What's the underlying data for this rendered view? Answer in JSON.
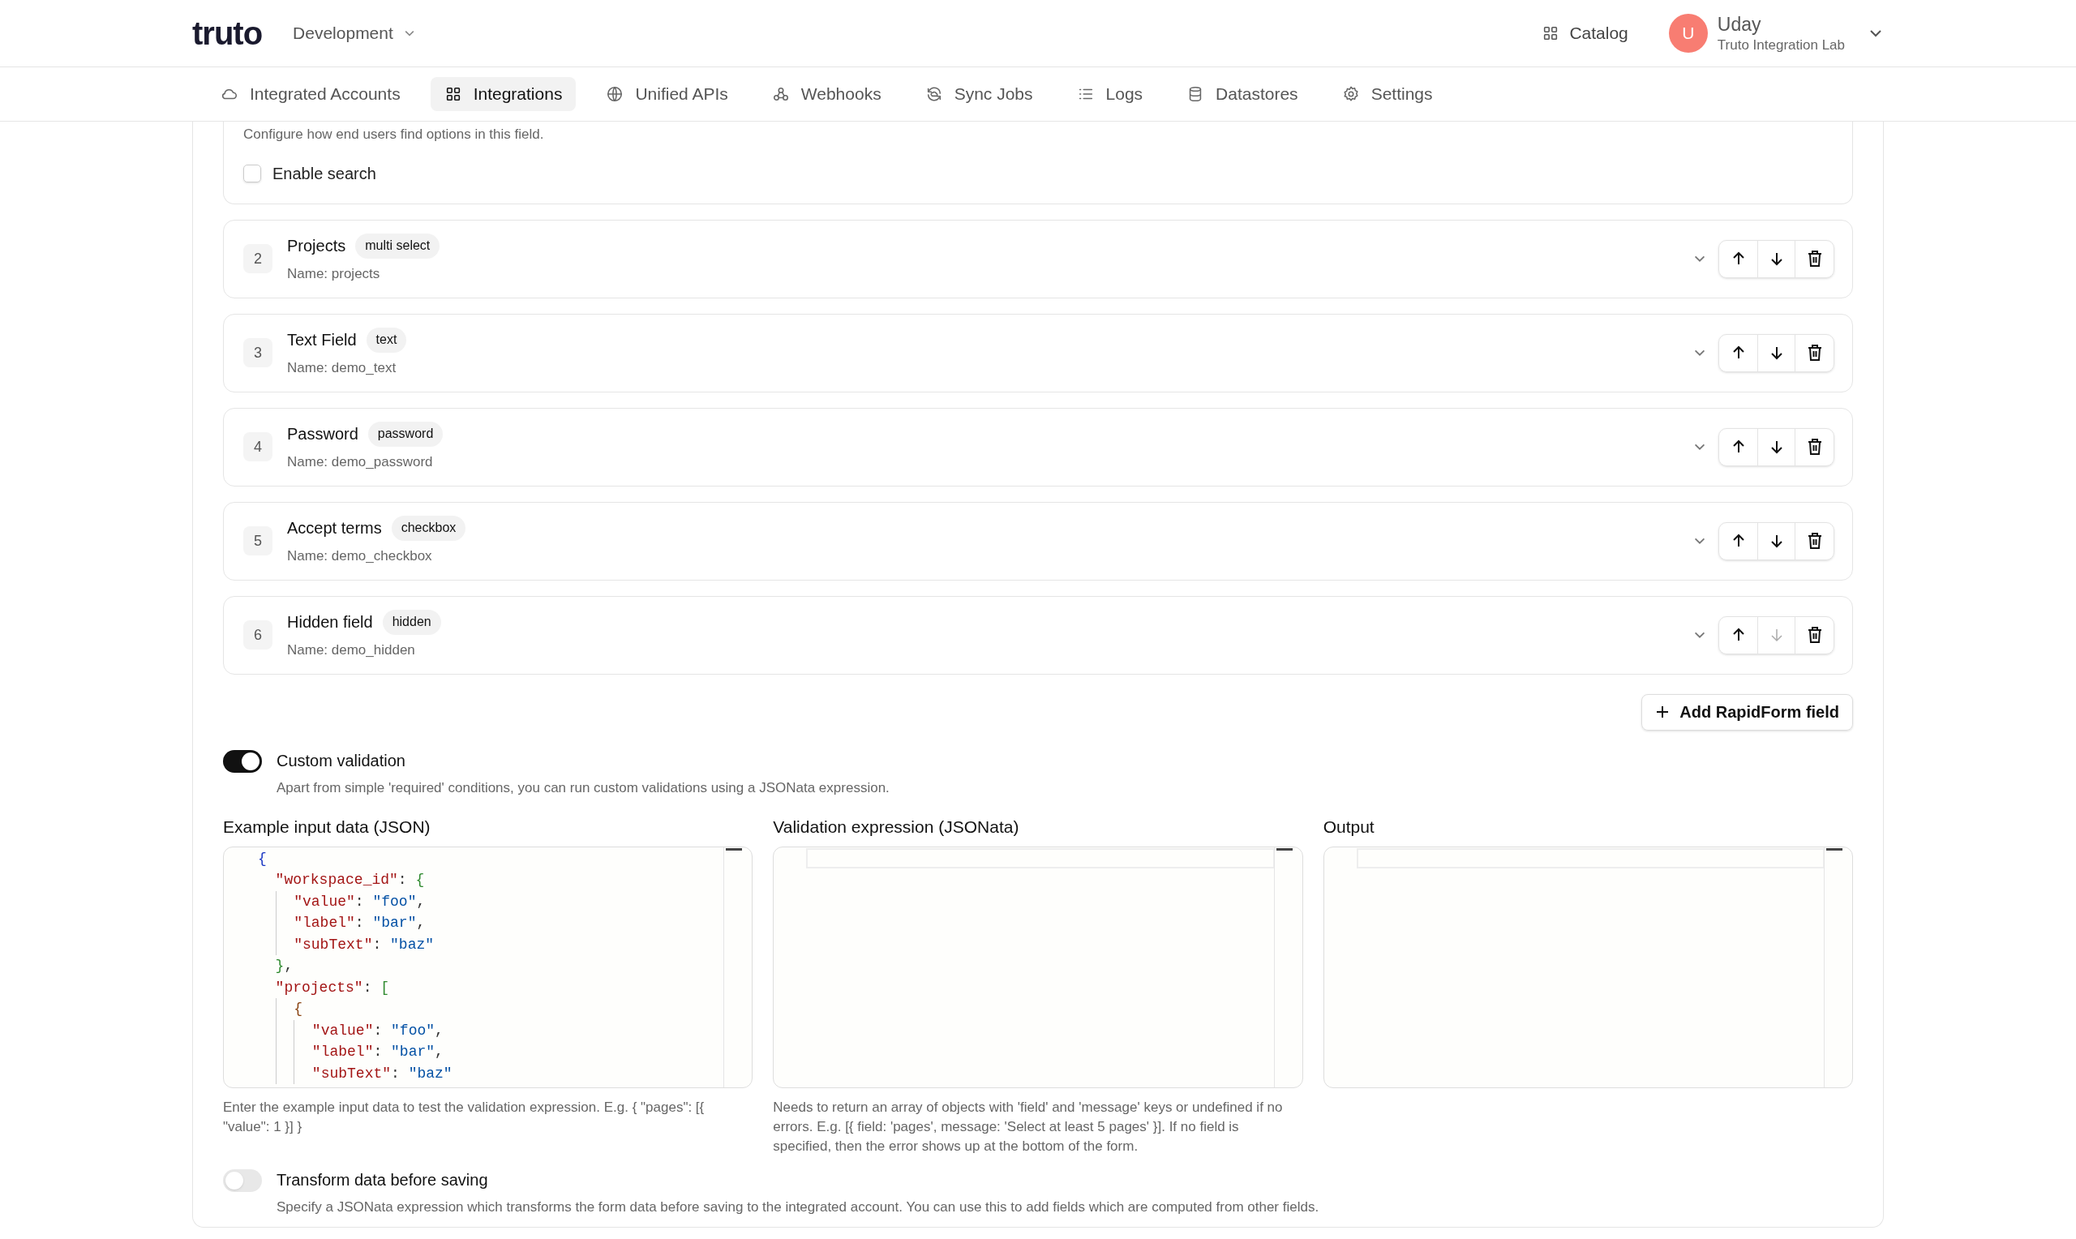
{
  "header": {
    "logo": "truto",
    "environment": "Development",
    "catalog": "Catalog",
    "user": {
      "initial": "U",
      "name": "Uday",
      "org": "Truto Integration Lab"
    }
  },
  "nav_tabs": [
    {
      "label": "Integrated Accounts",
      "selected": false
    },
    {
      "label": "Integrations",
      "selected": true
    },
    {
      "label": "Unified APIs",
      "selected": false
    },
    {
      "label": "Webhooks",
      "selected": false
    },
    {
      "label": "Sync Jobs",
      "selected": false
    },
    {
      "label": "Logs",
      "selected": false
    },
    {
      "label": "Datastores",
      "selected": false
    },
    {
      "label": "Settings",
      "selected": false
    }
  ],
  "search_config": {
    "description": "Configure how end users find options in this field.",
    "enable_search": {
      "label": "Enable search",
      "checked": false
    }
  },
  "fields": [
    {
      "number": "2",
      "title": "Projects",
      "type": "multi select",
      "name": "Name: projects",
      "down_disabled": false
    },
    {
      "number": "3",
      "title": "Text Field",
      "type": "text",
      "name": "Name: demo_text",
      "down_disabled": false
    },
    {
      "number": "4",
      "title": "Password",
      "type": "password",
      "name": "Name: demo_password",
      "down_disabled": false
    },
    {
      "number": "5",
      "title": "Accept terms",
      "type": "checkbox",
      "name": "Name: demo_checkbox",
      "down_disabled": false
    },
    {
      "number": "6",
      "title": "Hidden field",
      "type": "hidden",
      "name": "Name: demo_hidden",
      "down_disabled": true
    }
  ],
  "add_button": "Add RapidForm field",
  "custom_validation": {
    "title": "Custom validation",
    "description": "Apart from simple 'required' conditions, you can run custom validations using a JSONata expression.",
    "on": true
  },
  "editors": [
    {
      "label": "Example input data (JSON)",
      "lines": [
        "{",
        "  \"workspace_id\": {",
        "    \"value\": \"foo\",",
        "    \"label\": \"bar\",",
        "    \"subText\": \"baz\"",
        "  },",
        "  \"projects\": [",
        "    {",
        "      \"value\": \"foo\",",
        "      \"label\": \"bar\",",
        "      \"subText\": \"baz\""
      ],
      "help": "Enter the example input data to test the validation expression. E.g. { \"pages\": [{ \"value\": 1 }] }"
    },
    {
      "label": "Validation expression (JSONata)",
      "help": "Needs to return an array of objects with 'field' and 'message' keys or undefined if no errors. E.g. [{ field: 'pages', message: 'Select at least 5 pages' }]. If no field is specified, then the error shows up at the bottom of the form."
    },
    {
      "label": "Output"
    }
  ],
  "transform": {
    "title": "Transform data before saving",
    "description": "Specify a JSONata expression which transforms the form data before saving to the integrated account. You can use this to add fields which are computed from other fields.",
    "on": false
  }
}
